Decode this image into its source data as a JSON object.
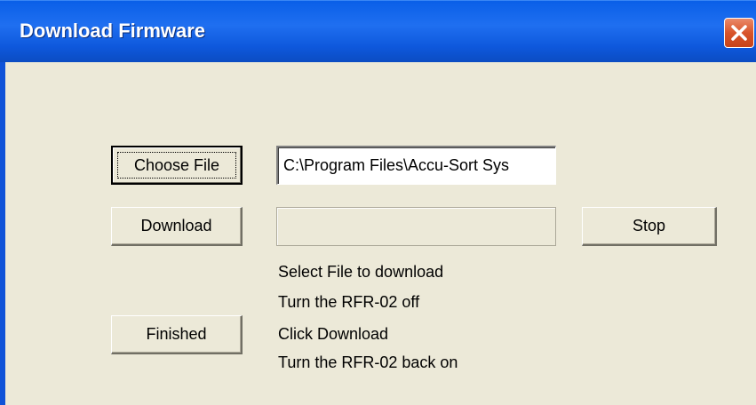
{
  "window": {
    "title": "Download Firmware"
  },
  "buttons": {
    "choose_file": "Choose File",
    "download": "Download",
    "stop": "Stop",
    "finished": "Finished"
  },
  "file_path": {
    "value": "C:\\Program Files\\Accu-Sort Sys"
  },
  "progress": {
    "fraction": 0
  },
  "instructions": [
    "Select File to download",
    "Turn the RFR-02 off",
    "Click Download",
    "Turn the RFR-02 back on"
  ],
  "icons": {
    "close": "close-icon"
  },
  "colors": {
    "title_bar": "#0a5fe8",
    "window_bg": "#ece9d8",
    "close_button": "#d8542a",
    "progress_fill": "#2f9a2f"
  }
}
